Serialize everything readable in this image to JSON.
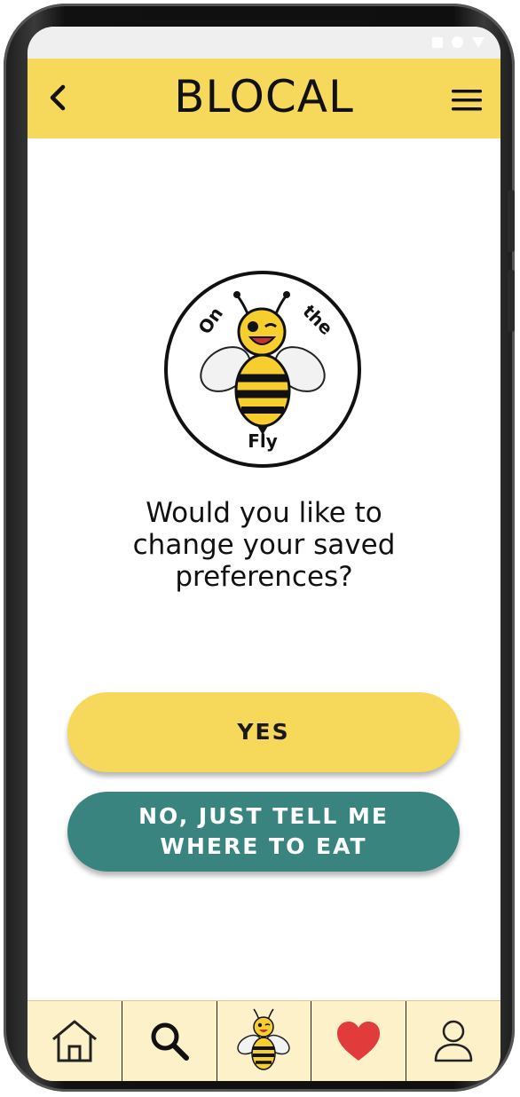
{
  "app": {
    "title": "BLOCAL"
  },
  "logo": {
    "top_word": "On",
    "right_word": "the",
    "bottom_word": "Fly"
  },
  "prompt": {
    "question_lines": [
      "Would you like to",
      "change your saved",
      "preferences?"
    ]
  },
  "actions": {
    "yes_label": "YES",
    "no_label_lines": [
      "NO, JUST TELL ME",
      "WHERE TO EAT"
    ]
  },
  "nav": {
    "items": [
      {
        "name": "home",
        "icon": "home-icon"
      },
      {
        "name": "search",
        "icon": "search-icon"
      },
      {
        "name": "bee",
        "icon": "bee-icon"
      },
      {
        "name": "favorites",
        "icon": "heart-icon"
      },
      {
        "name": "profile",
        "icon": "user-icon"
      }
    ]
  },
  "colors": {
    "brand_yellow": "#f6d85b",
    "teal": "#3a8480",
    "nav_background": "#fdf1c9",
    "heart_red": "#e23b3b"
  }
}
